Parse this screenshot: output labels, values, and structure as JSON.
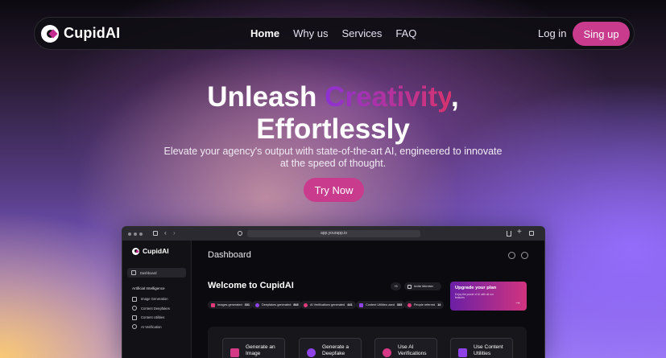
{
  "nav": {
    "brand": "CupidAI",
    "links": [
      "Home",
      "Why us",
      "Services",
      "FAQ"
    ],
    "login": "Log in",
    "signup": "Sing up"
  },
  "hero": {
    "title_a": "Unleash ",
    "title_highlight": "Creativity",
    "title_b": ",",
    "title_line2": "Effortlessly",
    "subtitle": "Elevate your agency's output with state-of-the-art AI, engineered to innovate at the speed of thought.",
    "cta": "Try Now"
  },
  "browser": {
    "url": "app.yourapp.io"
  },
  "app": {
    "brand": "CupidAI",
    "sidebar": {
      "dashboard": "Dashboard",
      "group": "Artificial Intelligence",
      "items": [
        "Image Generation",
        "Content Deepfakes",
        "Content Utilities",
        "AI Verification"
      ]
    },
    "title": "Dashboard",
    "welcome": "Welcome to CupidAI",
    "member_count": "+5",
    "invite": "Invite Member",
    "stats": [
      {
        "label": "Images generated",
        "value": "331",
        "color": "#e23b7c"
      },
      {
        "label": "Deepfakes generated",
        "value": "843",
        "color": "#8f43e6"
      },
      {
        "label": "AI Verifications generated",
        "value": "441",
        "color": "#e23b7c"
      },
      {
        "label": "Content Utilities used",
        "value": "333",
        "color": "#8f43e6"
      },
      {
        "label": "People referred",
        "value": "14",
        "color": "#e23b7c"
      }
    ],
    "upgrade": {
      "title": "Upgrade your plan",
      "text": "Enjoy the power of AI with all our features"
    },
    "cards": [
      "Generate an Image",
      "Generate a Deepfake",
      "Use AI Verifications",
      "Use Content Utilities"
    ]
  }
}
